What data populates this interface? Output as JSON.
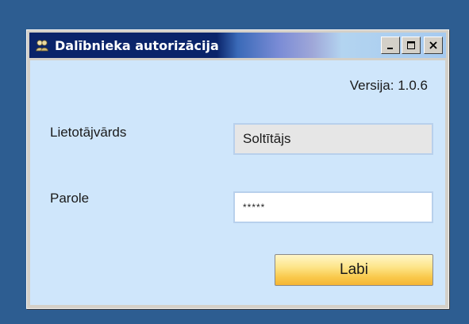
{
  "window": {
    "title": "Dalībnieka autorizācija",
    "title_icon": "app-icon",
    "buttons": {
      "minimize_icon": "minimize-icon",
      "maximize_icon": "maximize-icon",
      "close_icon": "close-icon"
    }
  },
  "form": {
    "version_text": "Versija: 1.0.6",
    "username_label": "Lietotājvārds",
    "username_value": "Soltītājs",
    "password_label": "Parole",
    "password_value": "*****",
    "ok_label": "Labi"
  },
  "colors": {
    "desktop": "#2d5d91",
    "client_bg": "#cfe6fb",
    "titlebar_dark": "#0a246a",
    "button_gold": "#f9c84a"
  }
}
